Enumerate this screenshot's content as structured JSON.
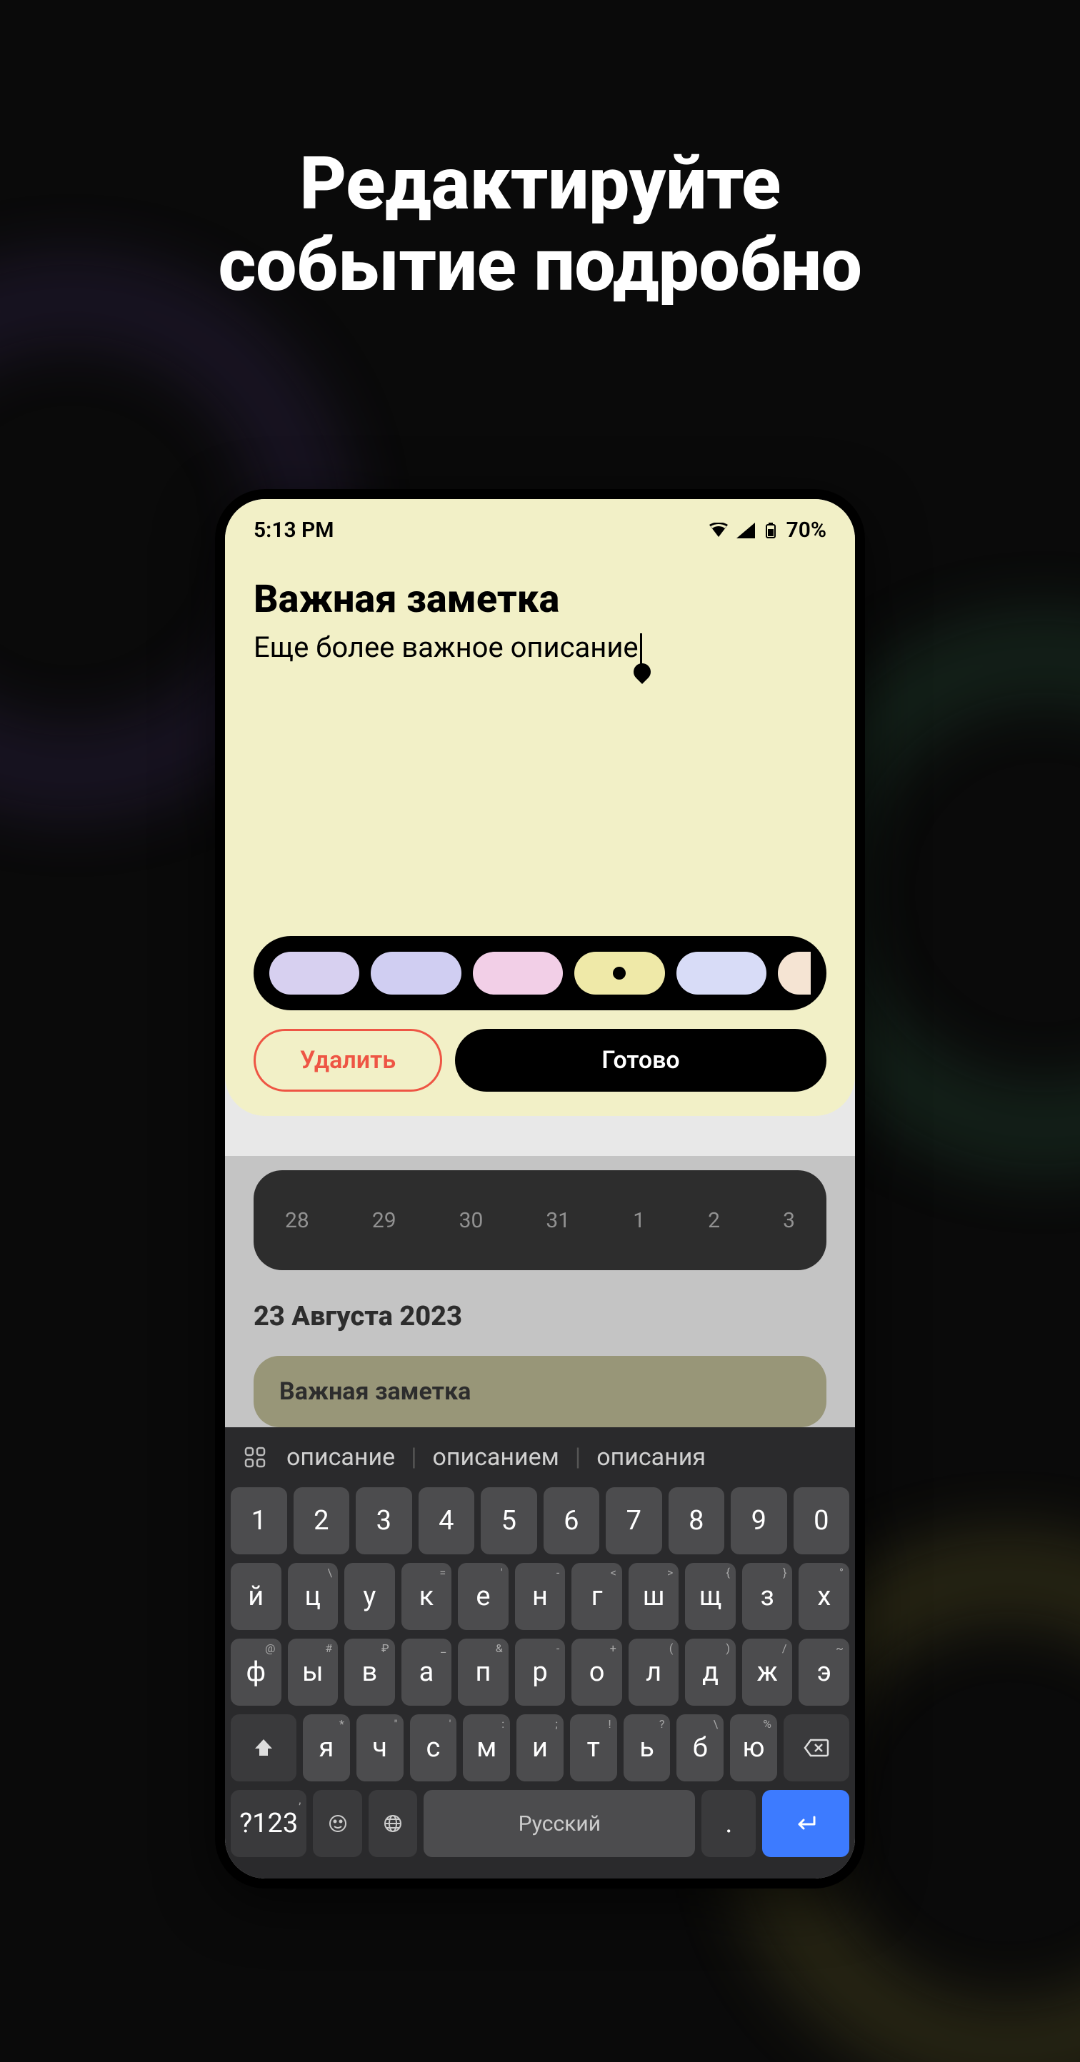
{
  "headline_line1": "Редактируйте",
  "headline_line2": "событие подробно",
  "status": {
    "time": "5:13 PM",
    "battery": "70%"
  },
  "editor": {
    "title": "Важная заметка",
    "description": "Еще более важное описание"
  },
  "colors": [
    {
      "hex": "#d7d0f0",
      "selected": false
    },
    {
      "hex": "#d0cef2",
      "selected": false
    },
    {
      "hex": "#f2cfe7",
      "selected": false
    },
    {
      "hex": "#efe9a8",
      "selected": true
    },
    {
      "hex": "#d8dcf7",
      "selected": false
    },
    {
      "hex": "#f5e4d3",
      "selected": false,
      "last": true
    }
  ],
  "buttons": {
    "delete": "Удалить",
    "done": "Готово"
  },
  "calendar_days": [
    "28",
    "29",
    "30",
    "31",
    "1",
    "2",
    "3"
  ],
  "section_date": "23 Августа 2023",
  "event_card_title": "Важная заметка",
  "keyboard": {
    "suggestions": [
      "описание",
      "описанием",
      "описания"
    ],
    "row_numbers": [
      "1",
      "2",
      "3",
      "4",
      "5",
      "6",
      "7",
      "8",
      "9",
      "0"
    ],
    "row1": [
      {
        "k": "й",
        "s": ""
      },
      {
        "k": "ц",
        "s": "\\"
      },
      {
        "k": "у",
        "s": ""
      },
      {
        "k": "к",
        "s": "="
      },
      {
        "k": "е",
        "s": "'"
      },
      {
        "k": "н",
        "s": "-"
      },
      {
        "k": "г",
        "s": "<"
      },
      {
        "k": "ш",
        "s": ">"
      },
      {
        "k": "щ",
        "s": "{"
      },
      {
        "k": "з",
        "s": "}"
      },
      {
        "k": "х",
        "s": "°"
      }
    ],
    "row2": [
      {
        "k": "ф",
        "s": "@"
      },
      {
        "k": "ы",
        "s": "#"
      },
      {
        "k": "в",
        "s": "₽"
      },
      {
        "k": "а",
        "s": "_"
      },
      {
        "k": "п",
        "s": "&"
      },
      {
        "k": "р",
        "s": "-"
      },
      {
        "k": "о",
        "s": "+"
      },
      {
        "k": "л",
        "s": "("
      },
      {
        "k": "д",
        "s": ")"
      },
      {
        "k": "ж",
        "s": "/"
      },
      {
        "k": "э",
        "s": "~"
      }
    ],
    "row3": [
      {
        "k": "я",
        "s": "*"
      },
      {
        "k": "ч",
        "s": "\""
      },
      {
        "k": "с",
        "s": "'"
      },
      {
        "k": "м",
        "s": ":"
      },
      {
        "k": "и",
        "s": ";"
      },
      {
        "k": "т",
        "s": "!"
      },
      {
        "k": "ь",
        "s": "?"
      },
      {
        "k": "б",
        "s": "\\"
      },
      {
        "k": "ю",
        "s": "%"
      }
    ],
    "symbols_key": "?123",
    "space_label": "Русский",
    "comma": ",",
    "period": "."
  }
}
